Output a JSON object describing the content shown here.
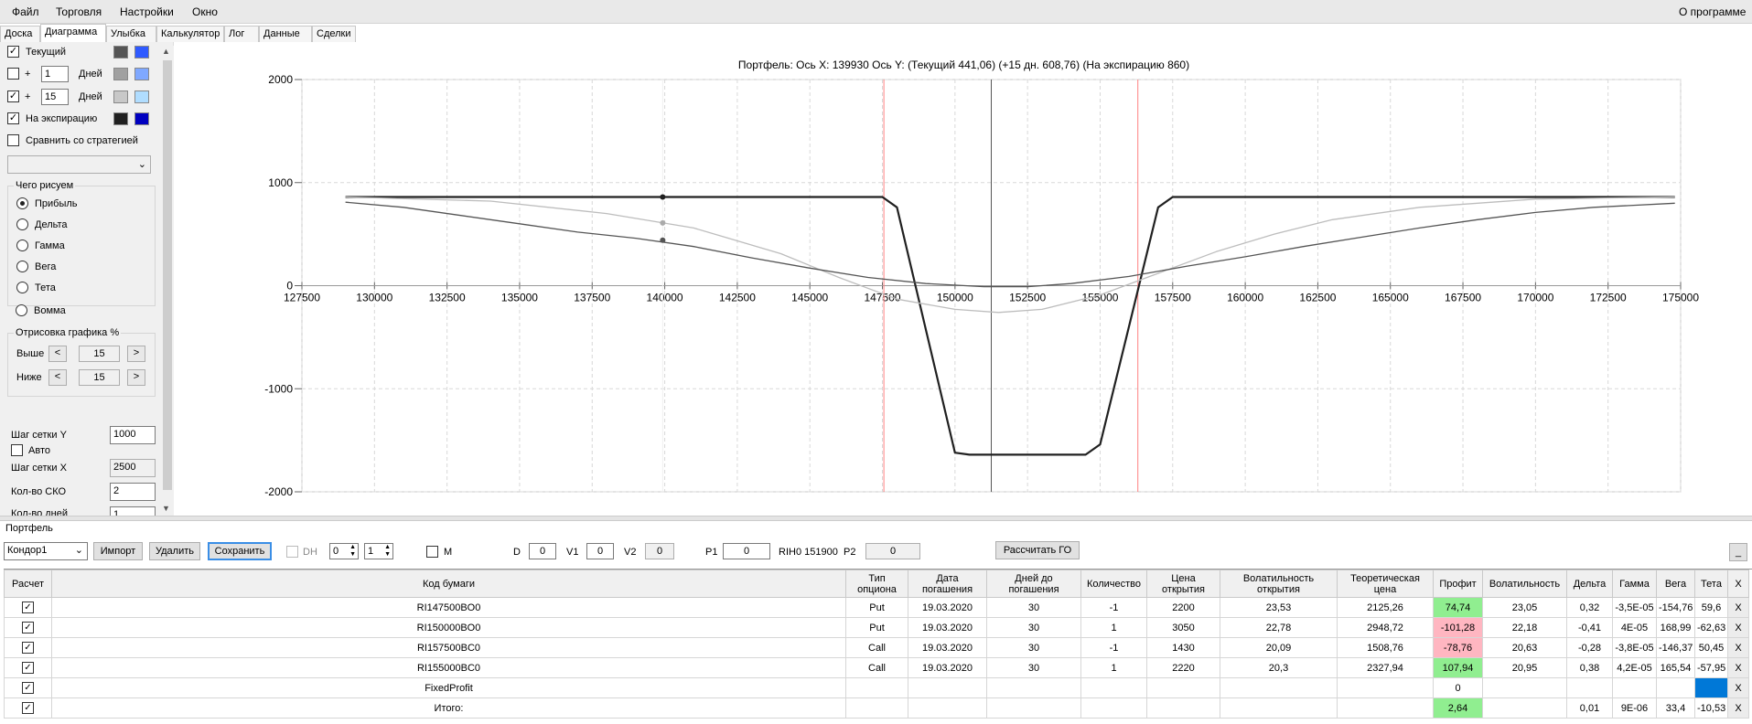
{
  "menu": {
    "file": "Файл",
    "trade": "Торговля",
    "settings": "Настройки",
    "window": "Окно",
    "about": "О программе"
  },
  "tabs": [
    "Доска",
    "Диаграмма",
    "Улыбка",
    "Калькулятор",
    "Лог",
    "Данные",
    "Сделки"
  ],
  "left": {
    "current_label": "Текущий",
    "plus": "+",
    "days1_value": "1",
    "days_label": "Дней",
    "days2_value": "15",
    "expiration_label": "На экспирацию",
    "compare_label": "Сравнить со стратегией",
    "draw_group": "Чего рисуем",
    "draw_options": [
      "Прибыль",
      "Дельта",
      "Гамма",
      "Вега",
      "Тета",
      "Вомма"
    ],
    "render_group": "Отрисовка графика %",
    "above_label": "Выше",
    "above_value": "15",
    "below_label": "Ниже",
    "below_value": "15",
    "lt": "<",
    "gt": ">",
    "grid_y_label": "Шаг сетки Y",
    "grid_y_value": "1000",
    "auto_label": "Авто",
    "grid_x_label": "Шаг сетки X",
    "grid_x_value": "2500",
    "sko_label": "Кол-во СКО",
    "sko_value": "2",
    "days_count_label": "Кол-во дней",
    "days_count_value": "1",
    "colors": {
      "current_dark": "#555555",
      "current_light": "#2f5aff",
      "d1_dark": "#a0a0a0",
      "d1_light": "#7fa8ff",
      "d15_dark": "#c8c8c8",
      "d15_light": "#b0ddff",
      "exp_dark": "#202020",
      "exp_light": "#0000c0"
    }
  },
  "chart_data": {
    "type": "line",
    "title": "Портфель:  Ось X: 139930 Ось Y:  (Текущий 441,06)  (+15 дн. 608,76)  (На экспирацию 860)",
    "xlim": [
      127500,
      175000
    ],
    "ylim": [
      -2000,
      2000
    ],
    "x_ticks": [
      "127500",
      "130000",
      "132500",
      "135000",
      "137500",
      "140000",
      "142500",
      "145000",
      "147500",
      "150000",
      "152500",
      "155000",
      "157500",
      "160000",
      "162500",
      "165000",
      "167500",
      "170000",
      "172500",
      "175000"
    ],
    "y_ticks": [
      "2000",
      "1000",
      "0",
      "-1000",
      "-2000"
    ],
    "grid": true,
    "vertical_markers": [
      {
        "x": 147550,
        "color": "#ff8080"
      },
      {
        "x": 151250,
        "color": "#555555"
      },
      {
        "x": 156300,
        "color": "#ff8080"
      }
    ],
    "cursor_x": 139930,
    "series": [
      {
        "color": "#202020",
        "points": [
          [
            129000,
            860
          ],
          [
            147500,
            860
          ],
          [
            148000,
            760
          ],
          [
            150000,
            -1620
          ],
          [
            150500,
            -1640
          ],
          [
            154500,
            -1640
          ],
          [
            155000,
            -1540
          ],
          [
            157000,
            760
          ],
          [
            157500,
            860
          ],
          [
            174800,
            860
          ]
        ],
        "marker": {
          "x": 139930,
          "y": 860
        }
      },
      {
        "color": "#bdbdbd",
        "points": [
          [
            129000,
            860
          ],
          [
            134000,
            820
          ],
          [
            138000,
            700
          ],
          [
            141000,
            560
          ],
          [
            144000,
            310
          ],
          [
            146000,
            80
          ],
          [
            148000,
            -130
          ],
          [
            150000,
            -230
          ],
          [
            151500,
            -260
          ],
          [
            153000,
            -230
          ],
          [
            155000,
            -90
          ],
          [
            157000,
            120
          ],
          [
            159000,
            330
          ],
          [
            161000,
            500
          ],
          [
            163000,
            640
          ],
          [
            166000,
            760
          ],
          [
            170000,
            840
          ],
          [
            174800,
            860
          ]
        ],
        "marker": {
          "x": 139930,
          "y": 608.76
        }
      },
      {
        "color": "#555555",
        "points": [
          [
            129000,
            810
          ],
          [
            131000,
            760
          ],
          [
            133000,
            680
          ],
          [
            135000,
            600
          ],
          [
            137000,
            520
          ],
          [
            139000,
            460
          ],
          [
            141000,
            380
          ],
          [
            143000,
            270
          ],
          [
            145000,
            170
          ],
          [
            147000,
            80
          ],
          [
            149000,
            20
          ],
          [
            151000,
            -10
          ],
          [
            152500,
            -10
          ],
          [
            154000,
            20
          ],
          [
            156000,
            90
          ],
          [
            158000,
            190
          ],
          [
            160000,
            280
          ],
          [
            162000,
            380
          ],
          [
            164000,
            470
          ],
          [
            166000,
            560
          ],
          [
            168000,
            640
          ],
          [
            170000,
            710
          ],
          [
            172000,
            760
          ],
          [
            174800,
            800
          ]
        ],
        "marker": {
          "x": 139930,
          "y": 441.06
        }
      }
    ]
  },
  "portfolio": {
    "label": "Портфель",
    "select_value": "Кондор1",
    "import_btn": "Импорт",
    "delete_btn": "Удалить",
    "save_btn": "Сохранить",
    "dh_label": "DH",
    "dh_value1": "0",
    "dh_value2": "1",
    "m_label": "M",
    "d_label": "D",
    "d_value": "0",
    "v1_label": "V1",
    "v1_value": "0",
    "v2_label": "V2",
    "v2_value": "0",
    "p1_label": "P1",
    "p1_value": "0",
    "rih_label": "RIH0 151900",
    "p2_label": "P2",
    "p2_value": "0",
    "calc_btn": "Рассчитать ГО",
    "minimize_btn": "_"
  },
  "table": {
    "headers": [
      "Расчет",
      "Код бумаги",
      "Тип опциона",
      "Дата погашения",
      "Дней до погашения",
      "Количество",
      "Цена открытия",
      "Волатильность открытия",
      "Теоретическая цена",
      "Профит",
      "Волатильность",
      "Дельта",
      "Гамма",
      "Вега",
      "Тета",
      "X"
    ],
    "rows": [
      [
        "RI147500BO0",
        "Put",
        "19.03.2020",
        "30",
        "-1",
        "2200",
        "23,53",
        "2125,26",
        "74,74",
        "23,05",
        "0,32",
        "-3,5E-05",
        "-154,76",
        "59,6",
        "X"
      ],
      [
        "RI150000BO0",
        "Put",
        "19.03.2020",
        "30",
        "1",
        "3050",
        "22,78",
        "2948,72",
        "-101,28",
        "22,18",
        "-0,41",
        "4E-05",
        "168,99",
        "-62,63",
        "X"
      ],
      [
        "RI157500BC0",
        "Call",
        "19.03.2020",
        "30",
        "-1",
        "1430",
        "20,09",
        "1508,76",
        "-78,76",
        "20,63",
        "-0,28",
        "-3,8E-05",
        "-146,37",
        "50,45",
        "X"
      ],
      [
        "RI155000BC0",
        "Call",
        "19.03.2020",
        "30",
        "1",
        "2220",
        "20,3",
        "2327,94",
        "107,94",
        "20,95",
        "0,38",
        "4,2E-05",
        "165,54",
        "-57,95",
        "X"
      ],
      [
        "FixedProfit",
        "",
        "",
        "",
        "",
        "",
        "",
        "",
        "0",
        "",
        "",
        "",
        "",
        "",
        "X"
      ],
      [
        "Итого:",
        "",
        "",
        "",
        "",
        "",
        "",
        "",
        "2,64",
        "",
        "0,01",
        "9E-06",
        "33,4",
        "-10,53",
        "X"
      ]
    ],
    "profit_colors": [
      "green",
      "pink",
      "pink",
      "green",
      "",
      "green"
    ],
    "check_mark": "✓"
  }
}
